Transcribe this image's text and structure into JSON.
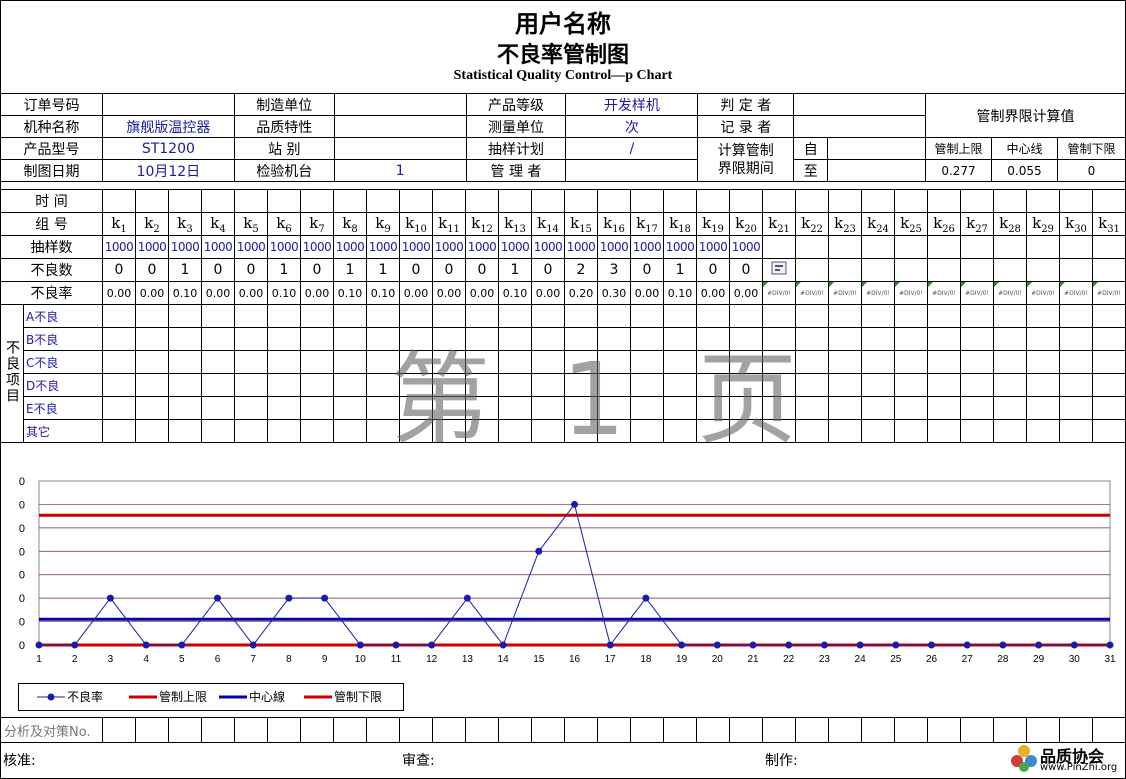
{
  "titles": {
    "main": "用户名称",
    "sub": "不良率管制图",
    "en": "Statistical Quality Control—p Chart"
  },
  "header": {
    "order_no_label": "订单号码",
    "order_no": "",
    "maker_label": "制造单位",
    "maker": "",
    "grade_label": "产品等级",
    "grade": "开发样机",
    "judge_label": "判 定 者",
    "judge": "",
    "model_label": "机种名称",
    "model": "旗舰版温控器",
    "quality_label": "品质特性",
    "quality": "",
    "unit_label": "测量单位",
    "unit": "次",
    "recorder_label": "记 录 者",
    "recorder": "",
    "type_label": "产品型号",
    "type": "ST1200",
    "station_label": "站 别",
    "station": "",
    "sampling_label": "抽样计划",
    "sampling": "/",
    "calc_label": "计算管制",
    "calc_label2": "界限期间",
    "from_label": "自",
    "to_label": "至",
    "date_label": "制图日期",
    "date": "10月12日",
    "machine_label": "检验机台",
    "machine": "1",
    "manager_label": "管 理 者",
    "manager": "",
    "limits_title": "管制界限计算值",
    "ucl_label": "管制上限",
    "cl_label": "中心线",
    "lcl_label": "管制下限",
    "ucl": "0.277",
    "cl": "0.055",
    "lcl": "0"
  },
  "grid": {
    "time_label": "时 间",
    "group_label": "组 号",
    "sample_label": "抽样数",
    "defect_label": "不良数",
    "rate_label": "不良率",
    "defect_items_label": "不良项目",
    "defect_items": [
      "A不良",
      "B不良",
      "C不良",
      "D不良",
      "E不良",
      "其它"
    ],
    "div_error": "#DIV/0!",
    "samples": [
      "1000",
      "1000",
      "1000",
      "1000",
      "1000",
      "1000",
      "1000",
      "1000",
      "1000",
      "1000",
      "1000",
      "1000",
      "1000",
      "1000",
      "1000",
      "1000",
      "1000",
      "1000",
      "1000",
      "1000"
    ],
    "defects": [
      "0",
      "0",
      "1",
      "0",
      "0",
      "1",
      "0",
      "1",
      "1",
      "0",
      "0",
      "0",
      "1",
      "0",
      "2",
      "3",
      "0",
      "1",
      "0",
      "0"
    ],
    "rates": [
      "0.00",
      "0.00",
      "0.10",
      "0.00",
      "0.00",
      "0.10",
      "0.00",
      "0.10",
      "0.10",
      "0.00",
      "0.00",
      "0.00",
      "0.10",
      "0.00",
      "0.20",
      "0.30",
      "0.00",
      "0.10",
      "0.00",
      "0.00"
    ]
  },
  "watermark": "第 1 页",
  "bottom": {
    "analysis_label": "分析及对策No.",
    "approve": "核准:",
    "review": "审查:",
    "make": "制作:"
  },
  "logo": {
    "name": "品质协会",
    "url": "www.PinZhi.org"
  },
  "colors": {
    "rate": "#1a1ab0",
    "ucl": "#cc0000",
    "cl": "#0000b0",
    "lcl": "#cc0000"
  },
  "chart_data": {
    "type": "line",
    "x": [
      1,
      2,
      3,
      4,
      5,
      6,
      7,
      8,
      9,
      10,
      11,
      12,
      13,
      14,
      15,
      16,
      17,
      18,
      19,
      20,
      21,
      22,
      23,
      24,
      25,
      26,
      27,
      28,
      29,
      30,
      31
    ],
    "series": [
      {
        "name": "不良率",
        "values": [
          0,
          0,
          0.1,
          0,
          0,
          0.1,
          0,
          0.1,
          0.1,
          0,
          0,
          0,
          0.1,
          0,
          0.2,
          0.3,
          0,
          0.1,
          0,
          0,
          0,
          0,
          0,
          0,
          0,
          0,
          0,
          0,
          0,
          0,
          0
        ]
      },
      {
        "name": "管制上限",
        "constant": 0.277
      },
      {
        "name": "中心線",
        "constant": 0.055
      },
      {
        "name": "管制下限",
        "constant": 0
      }
    ],
    "y_tick_labels": [
      "0",
      "0",
      "0",
      "0",
      "0",
      "0",
      "0",
      "0"
    ],
    "ylim": [
      0,
      0.35
    ],
    "legend": "bottom-left",
    "grid": true
  }
}
